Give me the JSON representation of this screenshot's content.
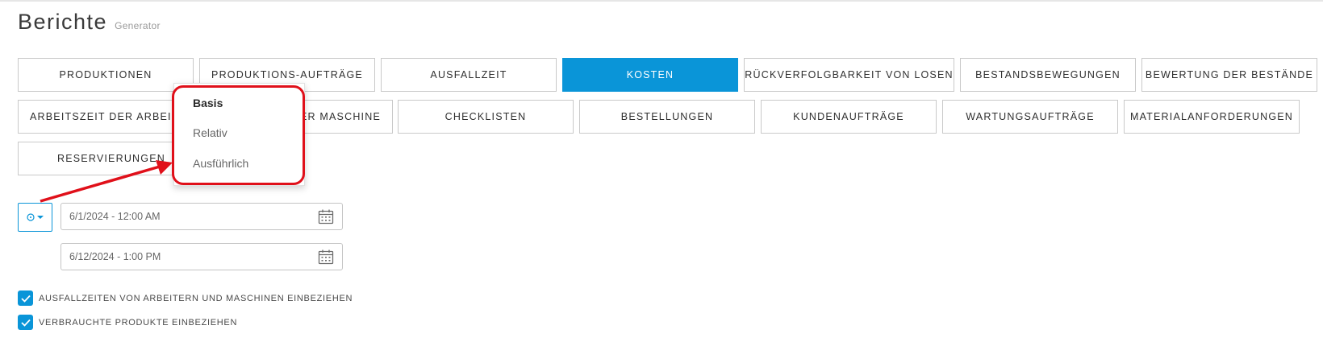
{
  "header": {
    "title": "Berichte",
    "subtitle": "Generator"
  },
  "tabs": [
    {
      "label": "PRODUKTIONEN"
    },
    {
      "label": "PRODUKTIONS-AUFTRÄGE"
    },
    {
      "label": "AUSFALLZEIT"
    },
    {
      "label": "KOSTEN",
      "active": true
    },
    {
      "label": "RÜCKVERFOLGBARKEIT VON LOSEN"
    },
    {
      "label": "BESTANDSBEWEGUNGEN"
    },
    {
      "label": "BEWERTUNG DER BESTÄNDE"
    },
    {
      "label": "ARBEITSZEIT DER ARBEITER"
    },
    {
      "label": "ZEITNUTZUNG DER MASCHINE"
    },
    {
      "label": "CHECKLISTEN"
    },
    {
      "label": "BESTELLUNGEN"
    },
    {
      "label": "KUNDENAUFTRÄGE"
    },
    {
      "label": "WARTUNGSAUFTRÄGE"
    },
    {
      "label": "MATERIALANFORDERUNGEN"
    },
    {
      "label": "RESERVIERUNGEN"
    }
  ],
  "date_mode_menu": {
    "options": [
      "Basis",
      "Relativ",
      "Ausführlich"
    ],
    "selected": "Basis"
  },
  "date_range": {
    "from": "6/1/2024 - 12:00 AM",
    "to": "6/12/2024 - 1:00 PM"
  },
  "options": [
    {
      "label": "AUSFALLZEITEN VON ARBEITERN UND MASCHINEN EINBEZIEHEN",
      "checked": true
    },
    {
      "label": "VERBRAUCHTE PRODUKTE EINBEZIEHEN",
      "checked": true
    }
  ],
  "colors": {
    "accent": "#0a95d8",
    "annotation": "#e0101a"
  }
}
